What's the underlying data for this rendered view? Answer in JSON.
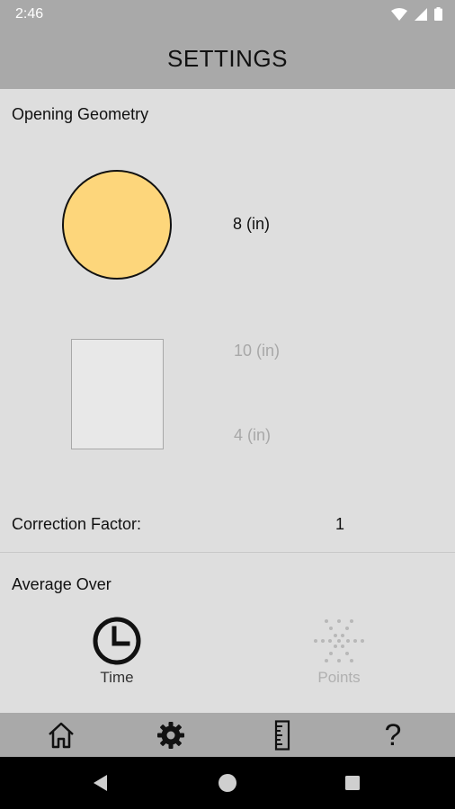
{
  "status_bar": {
    "time": "2:46",
    "icons": [
      "wifi-icon",
      "signal-icon",
      "battery-icon"
    ]
  },
  "header": {
    "title": "SETTINGS"
  },
  "opening_geometry": {
    "label": "Opening Geometry",
    "circle": {
      "diameter": "8 (in)",
      "selected": true,
      "fill_color": "#fdd67b"
    },
    "rectangle": {
      "length": "10 (in)",
      "width": "4 (in)",
      "selected": false
    }
  },
  "correction": {
    "label": "Correction Factor:",
    "value": "1"
  },
  "average_over": {
    "label": "Average Over",
    "options": [
      {
        "label": "Time",
        "icon": "clock-icon",
        "selected": true
      },
      {
        "label": "Points",
        "icon": "points-icon",
        "selected": false
      }
    ]
  },
  "tab_bar": {
    "tabs": [
      {
        "icon": "home-icon"
      },
      {
        "icon": "gear-icon",
        "active": true
      },
      {
        "icon": "ruler-icon"
      },
      {
        "icon": "help-icon"
      }
    ]
  },
  "nav_bar": {
    "buttons": [
      "back-icon",
      "home-circle-icon",
      "recents-icon"
    ]
  },
  "colors": {
    "bar_gray": "#a9a9a9",
    "background": "#dedede",
    "accent_yellow": "#fdd67b",
    "disabled_text": "#a8a8a8"
  }
}
